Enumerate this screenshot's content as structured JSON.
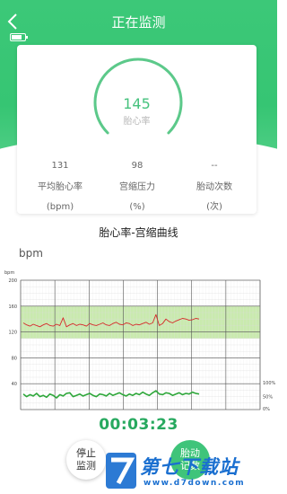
{
  "header": {
    "title": "正在监测",
    "back_icon": "chevron-left-icon",
    "battery_level": 0.7
  },
  "gauge": {
    "value": "145",
    "label": "胎心率",
    "color": "#5cc98a"
  },
  "stats": [
    {
      "value": "131",
      "label": "平均胎心率",
      "unit": "(bpm)"
    },
    {
      "value": "98",
      "label": "宫缩压力",
      "unit": "(%)"
    },
    {
      "value": "--",
      "label": "胎动次数",
      "unit": "(次)"
    }
  ],
  "chart_section": {
    "title": "胎心率-宫缩曲线",
    "unit_label": "bpm"
  },
  "chart_data": {
    "type": "line",
    "small_unit": "bpm",
    "y_left_ticks": [
      "200",
      "160",
      "120",
      "80",
      "40"
    ],
    "y_right_ticks": [
      "100%",
      "50%",
      "0%"
    ],
    "normal_band": [
      110,
      160
    ],
    "series": [
      {
        "values": [
          134,
          131,
          129,
          132,
          130,
          128,
          131,
          133,
          130,
          129,
          132,
          130,
          142,
          128,
          131,
          133,
          130,
          132,
          131,
          129,
          133,
          131,
          130,
          132,
          134,
          131,
          130,
          133,
          135,
          132,
          131,
          134,
          133,
          130,
          132,
          131,
          133,
          135,
          132,
          134,
          147,
          130,
          133,
          140,
          136,
          134,
          137,
          139,
          141,
          140,
          138,
          139,
          141,
          140
        ]
      },
      {
        "values": [
          24,
          20,
          23,
          21,
          25,
          20,
          22,
          19,
          24,
          22,
          18,
          23,
          21,
          25,
          26,
          20,
          22,
          24,
          21,
          23,
          25,
          22,
          20,
          24,
          23,
          21,
          25,
          22,
          24,
          26,
          23,
          21,
          24,
          22,
          25,
          23,
          27,
          24,
          22,
          26,
          29,
          24,
          23,
          26,
          25,
          22,
          24,
          26,
          23,
          25,
          24,
          27,
          25,
          24
        ]
      }
    ],
    "colors": {
      "fhr_line": "#d62b2b",
      "toco_line": "#2ea73a",
      "band": "#bfe6a0"
    }
  },
  "timer": "00:03:23",
  "buttons": {
    "stop": "停止监测",
    "record": "胎动记数"
  },
  "watermark": {
    "brand": "第七下载站",
    "url": "www.d7down.com"
  }
}
